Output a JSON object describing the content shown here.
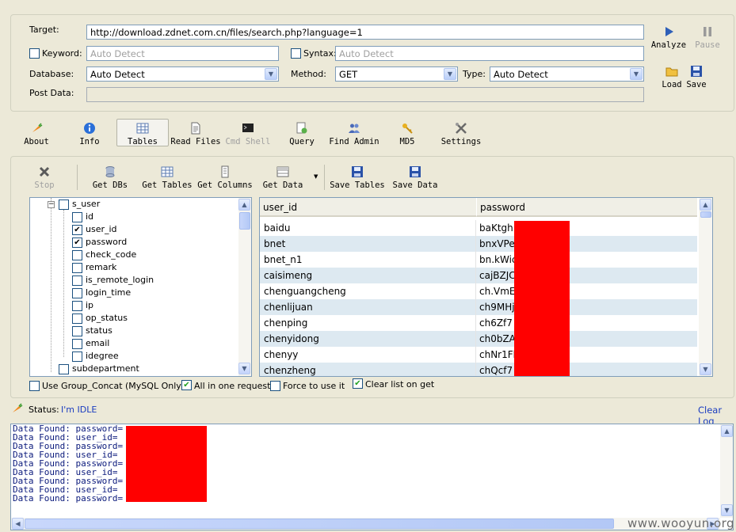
{
  "settings": {
    "target_label": "Target:",
    "target_value": "http://download.zdnet.com.cn/files/search.php?language=1",
    "keyword_label": "Keyword:",
    "keyword_value": "Auto Detect",
    "syntax_label": "Syntax:",
    "syntax_value": "Auto Detect",
    "database_label": "Database:",
    "database_value": "Auto Detect",
    "method_label": "Method:",
    "method_value": "GET",
    "type_label": "Type:",
    "type_value": "Auto Detect",
    "postdata_label": "Post Data:",
    "postdata_value": ""
  },
  "side_actions": {
    "analyze": "Analyze",
    "pause": "Pause",
    "load": "Load",
    "save": "Save"
  },
  "tabs": [
    {
      "label": "About",
      "icon": "carrot-icon"
    },
    {
      "label": "Info",
      "icon": "info-icon"
    },
    {
      "label": "Tables",
      "icon": "table-icon"
    },
    {
      "label": "Read Files",
      "icon": "document-icon"
    },
    {
      "label": "Cmd Shell",
      "icon": "terminal-icon"
    },
    {
      "label": "Query",
      "icon": "query-icon"
    },
    {
      "label": "Find Admin",
      "icon": "users-icon"
    },
    {
      "label": "MD5",
      "icon": "key-icon"
    },
    {
      "label": "Settings",
      "icon": "tools-icon"
    }
  ],
  "toolbar": {
    "stop": "Stop",
    "get_dbs": "Get DBs",
    "get_tables": "Get Tables",
    "get_columns": "Get Columns",
    "get_data": "Get Data",
    "save_tables": "Save Tables",
    "save_data": "Save Data"
  },
  "tree": {
    "table": "s_user",
    "columns": [
      {
        "name": "id",
        "checked": false
      },
      {
        "name": "user_id",
        "checked": true
      },
      {
        "name": "password",
        "checked": true
      },
      {
        "name": "check_code",
        "checked": false
      },
      {
        "name": "remark",
        "checked": false
      },
      {
        "name": "is_remote_login",
        "checked": false
      },
      {
        "name": "login_time",
        "checked": false
      },
      {
        "name": "ip",
        "checked": false
      },
      {
        "name": "op_status",
        "checked": false
      },
      {
        "name": "status",
        "checked": false
      },
      {
        "name": "email",
        "checked": false
      },
      {
        "name": "idegree",
        "checked": false
      }
    ],
    "next_table": "subdepartment"
  },
  "grid": {
    "columns": [
      "user_id",
      "password"
    ],
    "rows": [
      [
        "baidu",
        "baKtgh"
      ],
      [
        "bnet",
        "bnxVPe"
      ],
      [
        "bnet_n1",
        "bn.kWic"
      ],
      [
        "caisimeng",
        "cajBZJC"
      ],
      [
        "chenguangcheng",
        "ch.VmE"
      ],
      [
        "chenlijuan",
        "ch9MHj"
      ],
      [
        "chenping",
        "ch6Zf7"
      ],
      [
        "chenyidong",
        "ch0bZA"
      ],
      [
        "chenyy",
        "chNr1Fb"
      ],
      [
        "chenzheng",
        "chQcf7"
      ]
    ]
  },
  "options": {
    "group_concat": "Use Group_Concat (MySQL Only)",
    "all_in_one": "All in one request.",
    "force": "Force to use it",
    "clear_list": "Clear list on get"
  },
  "status": {
    "label": "Status:",
    "value": "I'm IDLE",
    "clear_log": "Clear Log"
  },
  "log": {
    "lines": [
      "Data Found: password=",
      "Data Found: user_id=",
      "Data Found: password=",
      "Data Found: user_id=",
      "Data Found: password=",
      "Data Found: user_id=",
      "Data Found: password=",
      "Data Found: user_id=",
      "Data Found: password="
    ]
  },
  "watermark": "www.wooyun.org",
  "colors": {
    "redaction": "#ff0000",
    "background": "#ece9d8",
    "log_text": "#0b1a7c",
    "status_value": "#1a3cc0"
  }
}
